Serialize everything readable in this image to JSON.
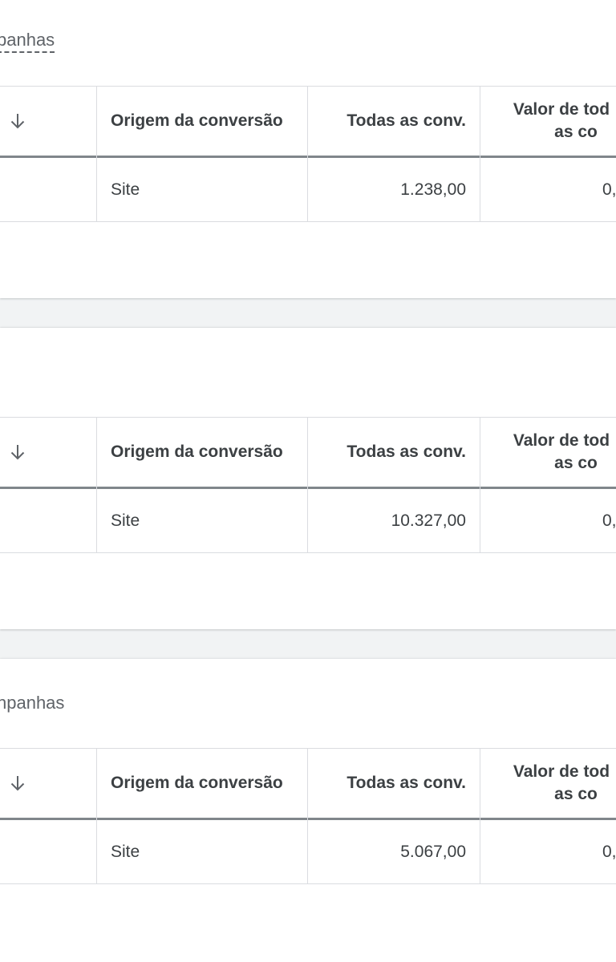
{
  "cards": [
    {
      "title": "panhas",
      "columns": {
        "origin": "Origem da conversão",
        "all_conv": "Todas as conv.",
        "value_line1": "Valor de tod",
        "value_line2": "as co"
      },
      "rows": [
        {
          "origin": "Site",
          "all_conv": "1.238,00",
          "value": "0,"
        }
      ]
    },
    {
      "title": "",
      "columns": {
        "origin": "Origem da conversão",
        "all_conv": "Todas as conv.",
        "value_line1": "Valor de tod",
        "value_line2": "as co"
      },
      "rows": [
        {
          "origin": "Site",
          "all_conv": "10.327,00",
          "value": "0,"
        }
      ]
    },
    {
      "title": "npanhas",
      "columns": {
        "origin": "Origem da conversão",
        "all_conv": "Todas as conv.",
        "value_line1": "Valor de tod",
        "value_line2": "as co"
      },
      "rows": [
        {
          "origin": "Site",
          "all_conv": "5.067,00",
          "value": "0,"
        }
      ]
    }
  ],
  "icons": {
    "sort": "arrow-down-icon"
  },
  "colors": {
    "background": "#f1f3f4",
    "card": "#ffffff",
    "text": "#3c4043",
    "muted": "#5f6368",
    "divider": "#dadce0",
    "header_rule": "#80868b"
  }
}
